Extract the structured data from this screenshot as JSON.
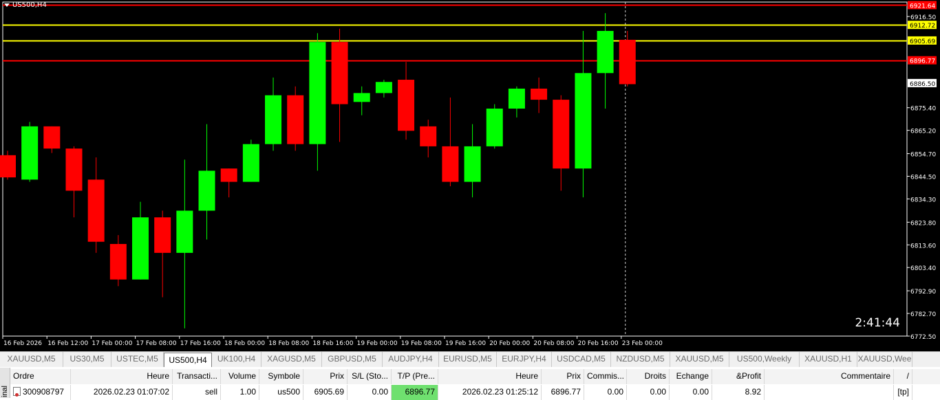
{
  "chart": {
    "symbol_title": "US500,H4",
    "countdown": "2:41:44",
    "colors": {
      "bull": "#00ff00",
      "bear": "#ff0000",
      "bg": "#000000",
      "axis": "#ffffff",
      "support": "#ffff00",
      "resist": "#ff0000"
    },
    "price_labels": [
      "6916.50",
      "6875.40",
      "6865.20",
      "6854.70",
      "6844.50",
      "6834.30",
      "6823.80",
      "6813.60",
      "6803.40",
      "6792.90",
      "6782.70",
      "6772.50"
    ],
    "current_price": "6886.50",
    "horizontal_lines": [
      {
        "price": 6921.64,
        "label": "6921.64",
        "color": "#ff0000"
      },
      {
        "price": 6912.72,
        "label": "6912.72",
        "color": "#ffff00"
      },
      {
        "price": 6905.69,
        "label": "6905.69",
        "color": "#ffff00"
      },
      {
        "price": 6896.77,
        "label": "6896.77",
        "color": "#ff0000"
      }
    ],
    "time_labels": [
      "16 Feb 2026",
      "16 Feb 12:00",
      "17 Feb 00:00",
      "17 Feb 08:00",
      "17 Feb 16:00",
      "18 Feb 00:00",
      "18 Feb 08:00",
      "18 Feb 16:00",
      "19 Feb 00:00",
      "19 Feb 08:00",
      "19 Feb 16:00",
      "20 Feb 00:00",
      "20 Feb 08:00",
      "20 Feb 16:00",
      "23 Feb 00:00"
    ]
  },
  "chart_data": {
    "type": "candlestick",
    "title": "US500,H4",
    "ylim": [
      6772.5,
      6923.0
    ],
    "candles": [
      {
        "o": 6854.0,
        "h": 6856.0,
        "l": 6843.0,
        "c": 6844.0
      },
      {
        "o": 6843.0,
        "h": 6869.0,
        "l": 6842.0,
        "c": 6867.0
      },
      {
        "o": 6867.0,
        "h": 6867.0,
        "l": 6855.0,
        "c": 6857.0
      },
      {
        "o": 6857.0,
        "h": 6858.0,
        "l": 6826.0,
        "c": 6838.0
      },
      {
        "o": 6843.0,
        "h": 6853.0,
        "l": 6810.0,
        "c": 6815.0
      },
      {
        "o": 6814.0,
        "h": 6818.0,
        "l": 6795.0,
        "c": 6798.0
      },
      {
        "o": 6798.0,
        "h": 6833.0,
        "l": 6798.0,
        "c": 6826.0
      },
      {
        "o": 6826.0,
        "h": 6829.0,
        "l": 6790.0,
        "c": 6810.0
      },
      {
        "o": 6810.0,
        "h": 6852.0,
        "l": 6776.0,
        "c": 6829.0
      },
      {
        "o": 6829.0,
        "h": 6868.0,
        "l": 6816.0,
        "c": 6847.0
      },
      {
        "o": 6848.0,
        "h": 6848.0,
        "l": 6835.0,
        "c": 6842.0
      },
      {
        "o": 6842.0,
        "h": 6861.0,
        "l": 6842.0,
        "c": 6859.0
      },
      {
        "o": 6859.0,
        "h": 6889.0,
        "l": 6856.0,
        "c": 6881.0
      },
      {
        "o": 6881.0,
        "h": 6885.0,
        "l": 6856.0,
        "c": 6859.0
      },
      {
        "o": 6859.0,
        "h": 6909.0,
        "l": 6847.0,
        "c": 6905.0
      },
      {
        "o": 6905.0,
        "h": 6911.0,
        "l": 6860.0,
        "c": 6877.0
      },
      {
        "o": 6878.0,
        "h": 6885.0,
        "l": 6872.0,
        "c": 6882.0
      },
      {
        "o": 6882.0,
        "h": 6888.0,
        "l": 6880.0,
        "c": 6887.0
      },
      {
        "o": 6888.0,
        "h": 6896.0,
        "l": 6861.0,
        "c": 6865.0
      },
      {
        "o": 6867.0,
        "h": 6870.0,
        "l": 6853.0,
        "c": 6858.0
      },
      {
        "o": 6858.0,
        "h": 6880.0,
        "l": 6840.0,
        "c": 6842.0
      },
      {
        "o": 6842.0,
        "h": 6868.0,
        "l": 6835.0,
        "c": 6858.0
      },
      {
        "o": 6858.0,
        "h": 6877.0,
        "l": 6857.0,
        "c": 6875.0
      },
      {
        "o": 6875.0,
        "h": 6885.0,
        "l": 6871.0,
        "c": 6884.0
      },
      {
        "o": 6884.0,
        "h": 6889.0,
        "l": 6873.0,
        "c": 6879.0
      },
      {
        "o": 6879.0,
        "h": 6881.0,
        "l": 6838.0,
        "c": 6848.0
      },
      {
        "o": 6848.0,
        "h": 6910.0,
        "l": 6835.0,
        "c": 6891.0
      },
      {
        "o": 6891.0,
        "h": 6918.0,
        "l": 6875.0,
        "c": 6910.0
      },
      {
        "o": 6906.0,
        "h": 6910.0,
        "l": 6885.0,
        "c": 6886.0
      }
    ]
  },
  "tabs": [
    {
      "label": "XAUUSD,M5",
      "w": 92
    },
    {
      "label": "US30,M5",
      "w": 70
    },
    {
      "label": "USTEC,M5",
      "w": 76
    },
    {
      "label": "US500,H4",
      "w": 70,
      "active": true
    },
    {
      "label": "UK100,H4",
      "w": 72
    },
    {
      "label": "XAGUSD,M5",
      "w": 88
    },
    {
      "label": "GBPUSD,M5",
      "w": 88
    },
    {
      "label": "AUDJPY,H4",
      "w": 82
    },
    {
      "label": "EURUSD,M5",
      "w": 84
    },
    {
      "label": "EURJPY,H4",
      "w": 80
    },
    {
      "label": "USDCAD,M5",
      "w": 86
    },
    {
      "label": "NZDUSD,M5",
      "w": 86
    },
    {
      "label": "XAUUSD,M5",
      "w": 86
    },
    {
      "label": "US500,Weekly",
      "w": 102
    },
    {
      "label": "XAUUSD,H1",
      "w": 84
    },
    {
      "label": "XAUUSD,Wee",
      "w": 80
    }
  ],
  "orders": {
    "side_label": "inal",
    "headers": [
      "Ordre",
      "Heure",
      "Transacti...",
      "Volume",
      "Symbole",
      "Prix",
      "S/L (Sto...",
      "T/P (Pre...",
      "Heure",
      "Prix",
      "Commis...",
      "Droits",
      "Echange",
      "&Profit",
      "Commentaire",
      "/"
    ],
    "row": [
      "300908797",
      "2026.02.23 01:07:02",
      "sell",
      "1.00",
      "us500",
      "6905.69",
      "0.00",
      "6896.77",
      "2026.02.23 01:25:12",
      "6896.77",
      "0.00",
      "0.00",
      "0.00",
      "8.92",
      "",
      "[tp]"
    ],
    "tp_highlight_color": "#6fe06f"
  }
}
